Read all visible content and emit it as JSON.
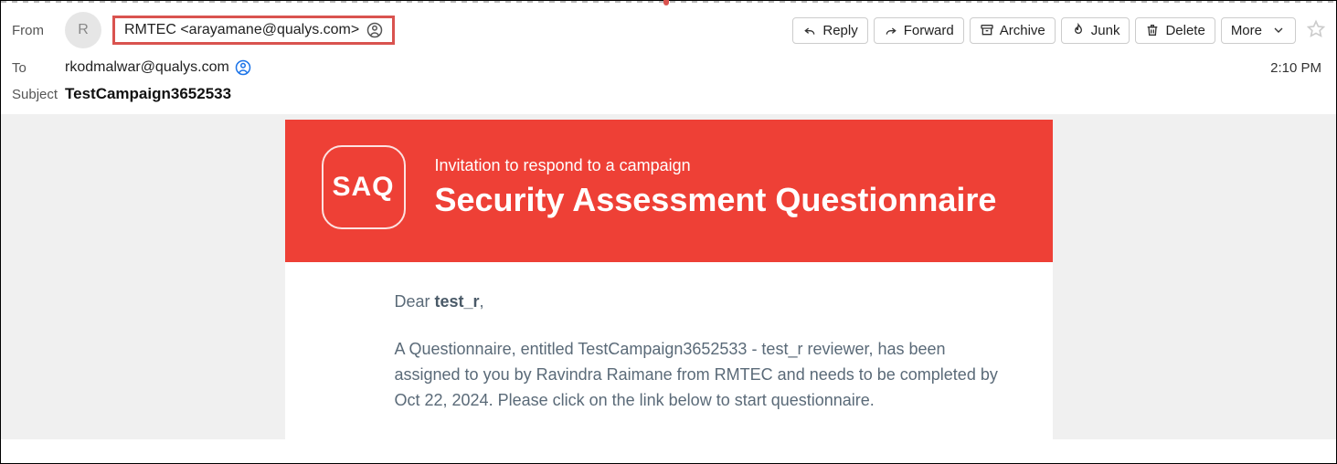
{
  "header": {
    "from_label": "From",
    "avatar_initial": "R",
    "from_display": "RMTEC <arayamane@qualys.com>",
    "to_label": "To",
    "to_value": "rkodmalwar@qualys.com",
    "time": "2:10 PM",
    "subject_label": "Subject",
    "subject_value": "TestCampaign3652533"
  },
  "toolbar": {
    "reply": "Reply",
    "forward": "Forward",
    "archive": "Archive",
    "junk": "Junk",
    "delete": "Delete",
    "more": "More"
  },
  "email": {
    "badge": "SAQ",
    "subtitle": "Invitation to respond to a campaign",
    "title": "Security Assessment Questionnaire",
    "greeting_prefix": "Dear ",
    "greeting_name": "test_r",
    "greeting_suffix": ",",
    "paragraph": "A Questionnaire, entitled TestCampaign3652533 - test_r reviewer, has been assigned to you by Ravindra Raimane from RMTEC and needs to be completed by Oct 22, 2024. Please click on the link below to start questionnaire."
  }
}
